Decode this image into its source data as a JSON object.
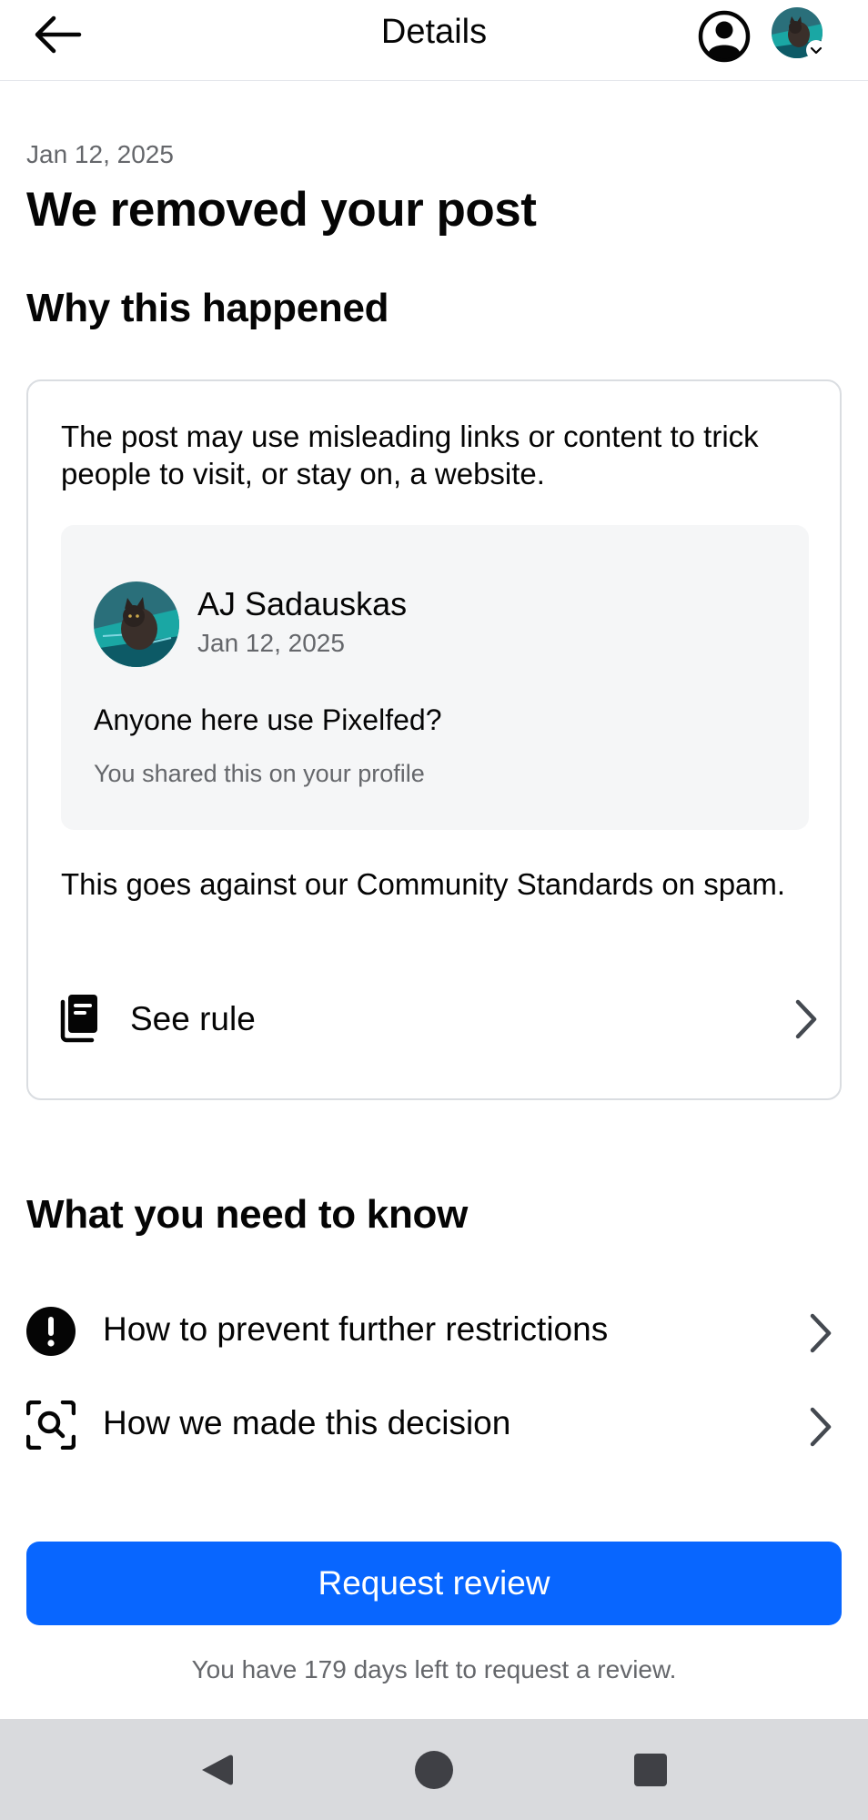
{
  "header": {
    "title": "Details",
    "back_icon": "arrow-left-icon",
    "profile_icon": "profile-circle-icon",
    "avatar_chevron_icon": "chevron-down-icon"
  },
  "notice": {
    "date": "Jan 12, 2025",
    "title": "We removed your post"
  },
  "why": {
    "heading": "Why this happened",
    "reason": "The post may use misleading links or content to trick people to visit, or stay on, a website.",
    "post": {
      "author": "AJ Sadauskas",
      "date": "Jan 12, 2025",
      "text": "Anyone here use Pixelfed?",
      "note": "You shared this on your profile"
    },
    "standards": "This goes against our Community Standards on spam.",
    "see_rule_label": "See rule",
    "see_rule_icon": "rulebook-icon"
  },
  "know": {
    "heading": "What you need to know",
    "items": [
      {
        "label": "How to prevent further restrictions",
        "icon": "exclamation-circle-icon"
      },
      {
        "label": "How we made this decision",
        "icon": "search-scan-icon"
      }
    ]
  },
  "review": {
    "button_label": "Request review",
    "days_left": "You have 179 days left to request a review."
  },
  "colors": {
    "primary": "#0866ff",
    "secondary_text": "#65676b",
    "preview_bg": "#f5f6f7",
    "nav_bar": "#d9dadd"
  }
}
